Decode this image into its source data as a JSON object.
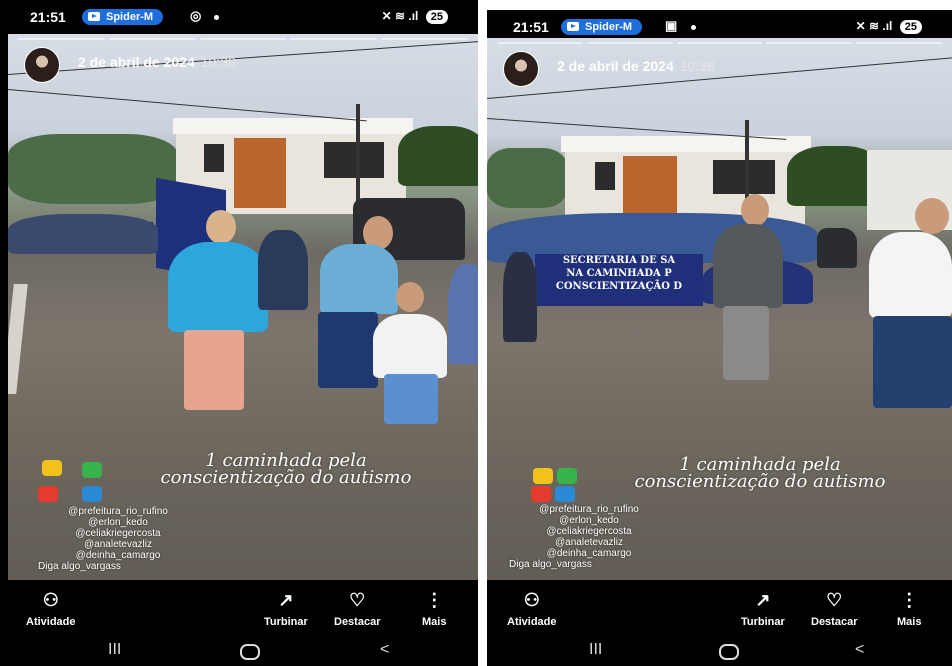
{
  "left": {
    "status": {
      "time": "21:51",
      "app_pill": "Spider-M",
      "battery": "25"
    },
    "story": {
      "date": "2 de abril de 2024",
      "time": "10:38"
    },
    "caption": [
      "1 caminhada pela",
      "conscientização do autismo"
    ],
    "tags": [
      "@prefeitura_rio_rufino",
      "@erlon_kedo",
      "@celiakriegercosta",
      "@analetevazliz",
      "@deinha_camargo",
      "Diga algo_vargass"
    ],
    "actions": {
      "activity": "Atividade",
      "boost": "Turbinar",
      "highlight": "Destacar",
      "more": "Mais"
    },
    "nav": {
      "recent": "III",
      "back": "<"
    }
  },
  "right": {
    "status": {
      "time": "21:51",
      "app_pill": "Spider-M",
      "battery": "25"
    },
    "story": {
      "date": "2 de abril de 2024",
      "time": "10:38"
    },
    "banner": [
      "SECRETARIA DE SA",
      "NA CAMINHADA P",
      "CONSCIENTIZAÇÃO D"
    ],
    "caption": [
      "1 caminhada pela",
      "conscientização do autismo"
    ],
    "tags": [
      "@prefeitura_rio_rufino",
      "@erlon_kedo",
      "@celiakriegercosta",
      "@analetevazliz",
      "@deinha_camargo",
      "Diga algo_vargass"
    ],
    "actions": {
      "activity": "Atividade",
      "boost": "Turbinar",
      "highlight": "Destacar",
      "more": "Mais"
    },
    "nav": {
      "recent": "III",
      "back": "<"
    }
  },
  "icons": {
    "youtube": "youtube-icon",
    "instagram": "instagram-icon",
    "mute": "mute-icon",
    "wifi": "wifi-icon",
    "signal": "signal-icon",
    "activity": "people-icon",
    "boost": "trending-up-icon",
    "highlight": "heart-circle-icon",
    "more": "vertical-dots-icon"
  },
  "colors": {
    "pill": "#1e6fdc",
    "banner": "#1f2f7a",
    "background": "#000000"
  }
}
